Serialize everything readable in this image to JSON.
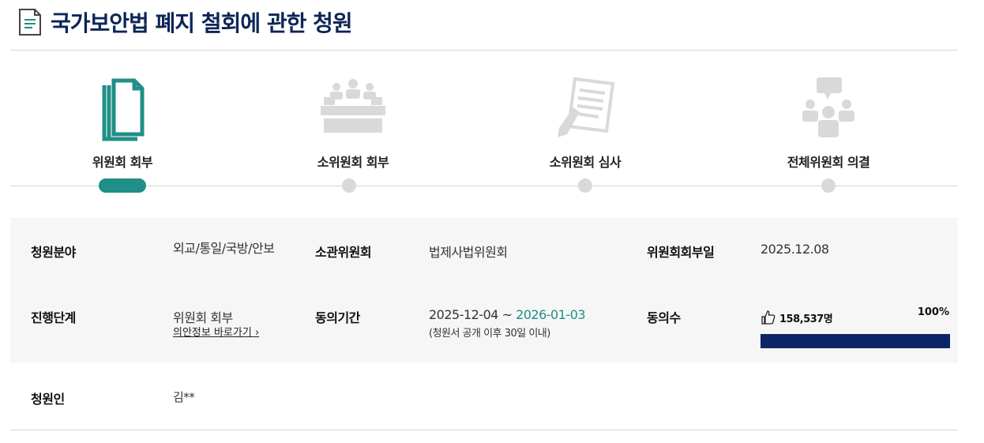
{
  "page": {
    "title": "국가보안법 폐지 철회에 관한 청원"
  },
  "steps": [
    {
      "label": "위원회 회부",
      "icon": "documents-icon",
      "active": true
    },
    {
      "label": "소위원회 회부",
      "icon": "meeting-table-icon",
      "active": false
    },
    {
      "label": "소위원회 심사",
      "icon": "review-document-icon",
      "active": false
    },
    {
      "label": "전체위원회 의결",
      "icon": "discussion-icon",
      "active": false
    }
  ],
  "info": {
    "field_label": "청원분야",
    "field_value": "외교/통일/국방/안보",
    "committee_label": "소관위원회",
    "committee_value": "법제사법위원회",
    "referral_date_label": "위원회회부일",
    "referral_date_value": "2025.12.08",
    "stage_label": "진행단계",
    "stage_value": "위원회 회부",
    "stage_link": "의안정보 바로가기 ›",
    "period_label": "동의기간",
    "period_start": "2025-12-04 ~ ",
    "period_end": "2026-01-03",
    "period_note": "(청원서 공개 이후 30일 이내)",
    "agree_label": "동의수",
    "agree_count": "158,537명",
    "agree_percent": "100%",
    "agree_progress": 1.0,
    "petitioner_label": "청원인",
    "petitioner_value": "김**"
  },
  "colors": {
    "accent": "#1f8f87",
    "title": "#0d2557",
    "progress": "#0d2567",
    "inactive": "#d9d9d9"
  }
}
